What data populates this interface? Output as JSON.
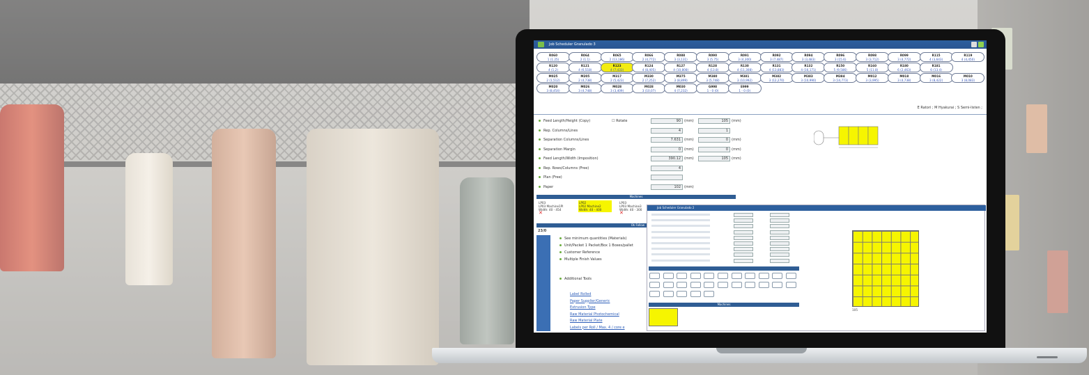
{
  "app": {
    "title": "Job Scheduler Granulado 3",
    "legend": "E Ratori ; M Hyakurai ; S Semi-listen ;"
  },
  "jobs": [
    {
      "code": "R060",
      "val": "1 (1.25)"
    },
    {
      "code": "R064",
      "val": "2 (1.1)"
    },
    {
      "code": "R065",
      "val": "2 (13,186)"
    },
    {
      "code": "R066",
      "val": "2 (4,772)"
    },
    {
      "code": "R088",
      "val": "3 (3,131)"
    },
    {
      "code": "R090",
      "val": "3 (5.75)"
    },
    {
      "code": "R091",
      "val": "3 (4,300)"
    },
    {
      "code": "R092",
      "val": "3 (7,487)"
    },
    {
      "code": "R094",
      "val": "3 (3,483)"
    },
    {
      "code": "R096",
      "val": "3 (15.6)"
    },
    {
      "code": "R098",
      "val": "3 (3,712)"
    },
    {
      "code": "R099",
      "val": "3 (4,772)"
    },
    {
      "code": "R115",
      "val": "4 (3,643)"
    },
    {
      "code": "R119",
      "val": "4 (4,450)"
    },
    {
      "code": "R120",
      "val": "4 (1,2)"
    },
    {
      "code": "R121",
      "val": "4 (6,518)"
    },
    {
      "code": "R123",
      "val": "4 (7,433)"
    },
    {
      "code": "R124",
      "val": "4 (8,405)"
    },
    {
      "code": "R127",
      "val": "4 (10,808)"
    },
    {
      "code": "R128",
      "val": "4 (13.8)"
    },
    {
      "code": "R130",
      "val": "4 (11,308)"
    },
    {
      "code": "R131",
      "val": "4 (13,883)"
    },
    {
      "code": "R132",
      "val": "4 (16,171)"
    },
    {
      "code": "R150",
      "val": "5 (9,586)"
    },
    {
      "code": "R160",
      "val": "5 (11.8)"
    },
    {
      "code": "R180",
      "val": "6 (2,463)"
    },
    {
      "code": "R181",
      "val": "6 (13.4)"
    },
    {
      "code": "M025",
      "val": "2 (1,512)"
    },
    {
      "code": "M205",
      "val": "2 (4,738)"
    },
    {
      "code": "M317",
      "val": "2 (5,423)"
    },
    {
      "code": "M330",
      "val": "2 (7,252)"
    },
    {
      "code": "M375",
      "val": "3 (8,899)"
    },
    {
      "code": "M380",
      "val": "3 (5,748)"
    },
    {
      "code": "M381",
      "val": "3 (10,992)"
    },
    {
      "code": "M382",
      "val": "3 (12,270)"
    },
    {
      "code": "M383",
      "val": "3 (10,990)"
    },
    {
      "code": "M384",
      "val": "3 (14,773)"
    },
    {
      "code": "M012",
      "val": "3 (3,995)"
    },
    {
      "code": "M018",
      "val": "3 (4,738)"
    },
    {
      "code": "M016",
      "val": "3 (8,422)"
    },
    {
      "code": "M010",
      "val": "3 (8,083)"
    },
    {
      "code": "M020",
      "val": "3 (8,454)"
    },
    {
      "code": "M026",
      "val": "3 (4,748)"
    },
    {
      "code": "M028",
      "val": "3 (3,409)"
    },
    {
      "code": "M028",
      "val": "3 (10,07)"
    },
    {
      "code": "M030",
      "val": "4 (7,232)"
    },
    {
      "code": "G998",
      "val": "1 - 0 (0)"
    },
    {
      "code": "E999",
      "val": "1 - 0 (0)"
    }
  ],
  "form": {
    "rows": [
      {
        "label": "Feed Length/Height (Copy)",
        "extra": "Rotate",
        "v1": "90",
        "u1": "(mm)",
        "v2": "105",
        "u2": "(mm)"
      },
      {
        "label": "Rep. Columns/Lines",
        "v1": "4",
        "v2": "1"
      },
      {
        "label": "Separation Columns/Lines",
        "v1": "7.631",
        "u1": "(mm)",
        "v2": "0",
        "u2": "(mm)"
      },
      {
        "label": "Separation Margin",
        "v1": "0",
        "u1": "(mm)",
        "v2": "0",
        "u2": "(mm)"
      },
      {
        "label": "Feed Length/Width (Imposition)",
        "v1": "390.12",
        "u1": "(mm)",
        "v2": "105",
        "u2": "(mm)"
      },
      {
        "label": "Rep. Rows/Columns (Free)",
        "v1": "4"
      },
      {
        "label": "Plan (Free)",
        "v1": ""
      },
      {
        "label": "Paper",
        "v1": "102",
        "u1": "(mm)"
      }
    ],
    "machines_label": "Machines"
  },
  "machines": [
    {
      "name": "LP03",
      "l1": "LP03 Machine1Pl",
      "l2": "Width: 40 - 454"
    },
    {
      "name": "LP02",
      "l1": "LP02 Machine2",
      "l2": "Width: 40 - 400"
    },
    {
      "name": "LP03",
      "l1": "LP03 Machine3",
      "l2": "Width: 40 - 300"
    }
  ],
  "lower": {
    "count": "23/0",
    "side_head": "Ok Follow",
    "items": [
      "See minimum quantities (Materials)",
      "Unit/Packet 1 Packet/Box 1 Boxes/pallet",
      "Customer Reference",
      "Multiple Finish Values",
      "Additional Tools"
    ],
    "links": [
      "Label Rolled",
      "Paper Supplier/Generic",
      "Extrusion Type",
      "Raw Material Photochemical",
      "Raw Material Plate",
      "Labels per Roll / Max. 4 / core e"
    ]
  },
  "sub": {
    "title": "Job Scheduler Granulado 2",
    "machines_label": "Machines",
    "dim": "105"
  }
}
